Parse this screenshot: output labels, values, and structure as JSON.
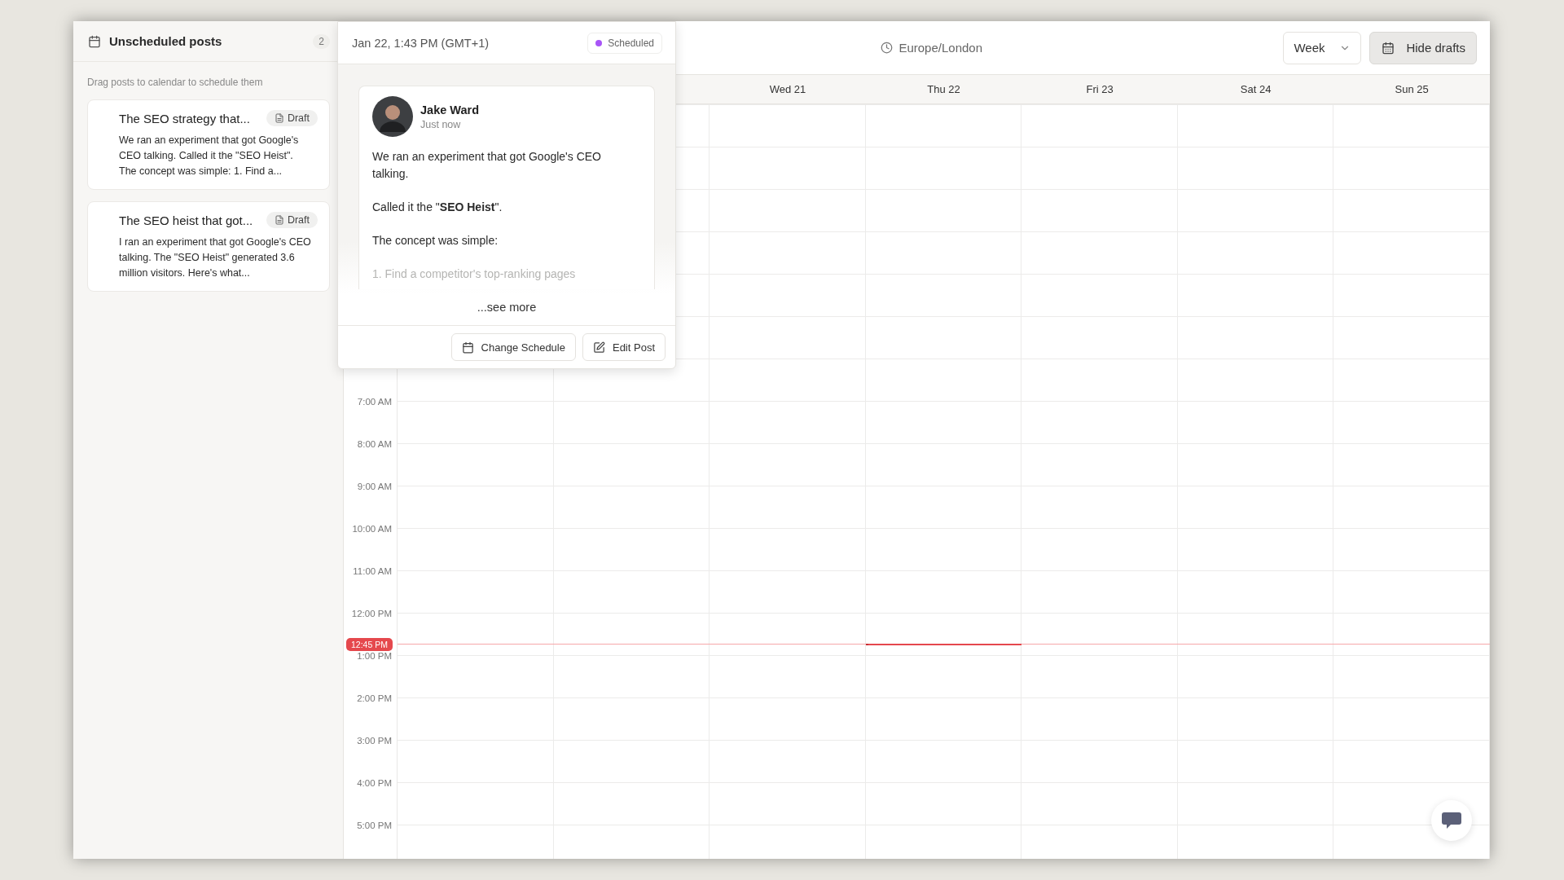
{
  "sidebar": {
    "title": "Unscheduled posts",
    "count": "2",
    "hint": "Drag posts to calendar to schedule them",
    "posts": [
      {
        "title": "The SEO strategy that...",
        "status": "Draft",
        "excerpt": "We ran an experiment that got Google's CEO talking. Called it the \"SEO Heist\". The concept was simple: 1. Find a..."
      },
      {
        "title": "The SEO heist that got...",
        "status": "Draft",
        "excerpt": "I ran an experiment that got Google's CEO talking. The \"SEO Heist\" generated 3.6 million visitors. Here's what..."
      }
    ]
  },
  "post_popup": {
    "scheduled_time": "Jan 22, 1:43 PM (GMT+1)",
    "status": {
      "label": "Scheduled",
      "color": "#a855f7"
    },
    "author": "Jake Ward",
    "posted": "Just now",
    "paragraphs": [
      {
        "text": "We ran an experiment that got Google's CEO talking.",
        "faded": false
      },
      {
        "text": "Called it the \"**SEO Heist**\".",
        "faded": false
      },
      {
        "text": "The concept was simple:",
        "faded": false
      },
      {
        "text": "1. Find a competitor's top-ranking pages",
        "faded": true
      }
    ],
    "see_more": "...see more",
    "actions": [
      {
        "label": "Change Schedule",
        "kind": "schedule"
      },
      {
        "label": "Edit Post",
        "kind": "edit"
      }
    ]
  },
  "toolbar": {
    "timezone": "Europe/London",
    "view": "Week",
    "hide_drafts": "Hide drafts"
  },
  "calendar": {
    "days": [
      {
        "label": "Wed 21",
        "today": false
      },
      {
        "label": "Thu 22",
        "today": true
      },
      {
        "label": "Fri 23",
        "today": false
      },
      {
        "label": "Sat 24",
        "today": false
      },
      {
        "label": "Sun 25",
        "today": false
      }
    ],
    "hours": [
      "7:00 AM",
      "8:00 AM",
      "9:00 AM",
      "10:00 AM",
      "11:00 AM",
      "12:00 PM",
      "1:00 PM",
      "2:00 PM",
      "3:00 PM",
      "4:00 PM",
      "5:00 PM"
    ],
    "now": "12:45 PM"
  }
}
